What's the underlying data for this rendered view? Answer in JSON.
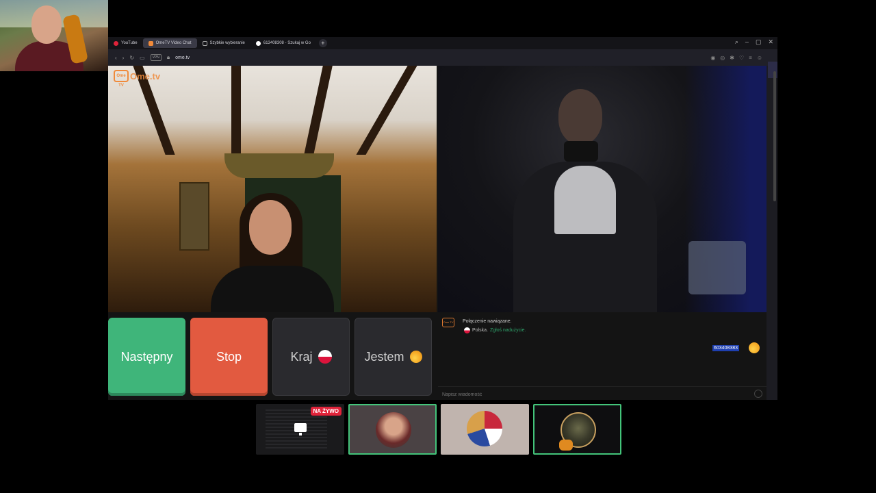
{
  "browser": {
    "tabs": [
      {
        "label": "YouTube",
        "active": false,
        "icon": "youtube-icon",
        "color": "#e0233a"
      },
      {
        "label": "OmeTV Video Chat",
        "active": true,
        "icon": "ometv-icon",
        "color": "#f08a3a"
      },
      {
        "label": "Szybkie wybieranie",
        "active": false,
        "icon": "speed-dial-icon",
        "color": "#aaaaaa"
      },
      {
        "label": "613408308 - Szukaj w Go",
        "active": false,
        "icon": "google-icon",
        "color": "#ffffff"
      }
    ],
    "new_tab": "+",
    "vpn_label": "VPN",
    "url": "ome.tv"
  },
  "ometv": {
    "logo_tv": "Ome TV",
    "logo_text": "Ome.tv"
  },
  "controls": {
    "next_label": "Następny",
    "stop_label": "Stop",
    "country_label": "Kraj",
    "gender_label": "Jestem",
    "colors": {
      "next": "#3fb57a",
      "stop": "#e25a40",
      "neutral": "#2a2a2e"
    }
  },
  "chat": {
    "logo": "Ome TV",
    "connected_text": "Połączenie nawiązane.",
    "country_text": "Polska.",
    "report_link": "Zgłoś nadużycie.",
    "my_message": "603408383",
    "input_placeholder": "Napisz wiadomość"
  },
  "participants": {
    "live_badge": "NA ŻYWO",
    "accent": "#43c47a"
  }
}
